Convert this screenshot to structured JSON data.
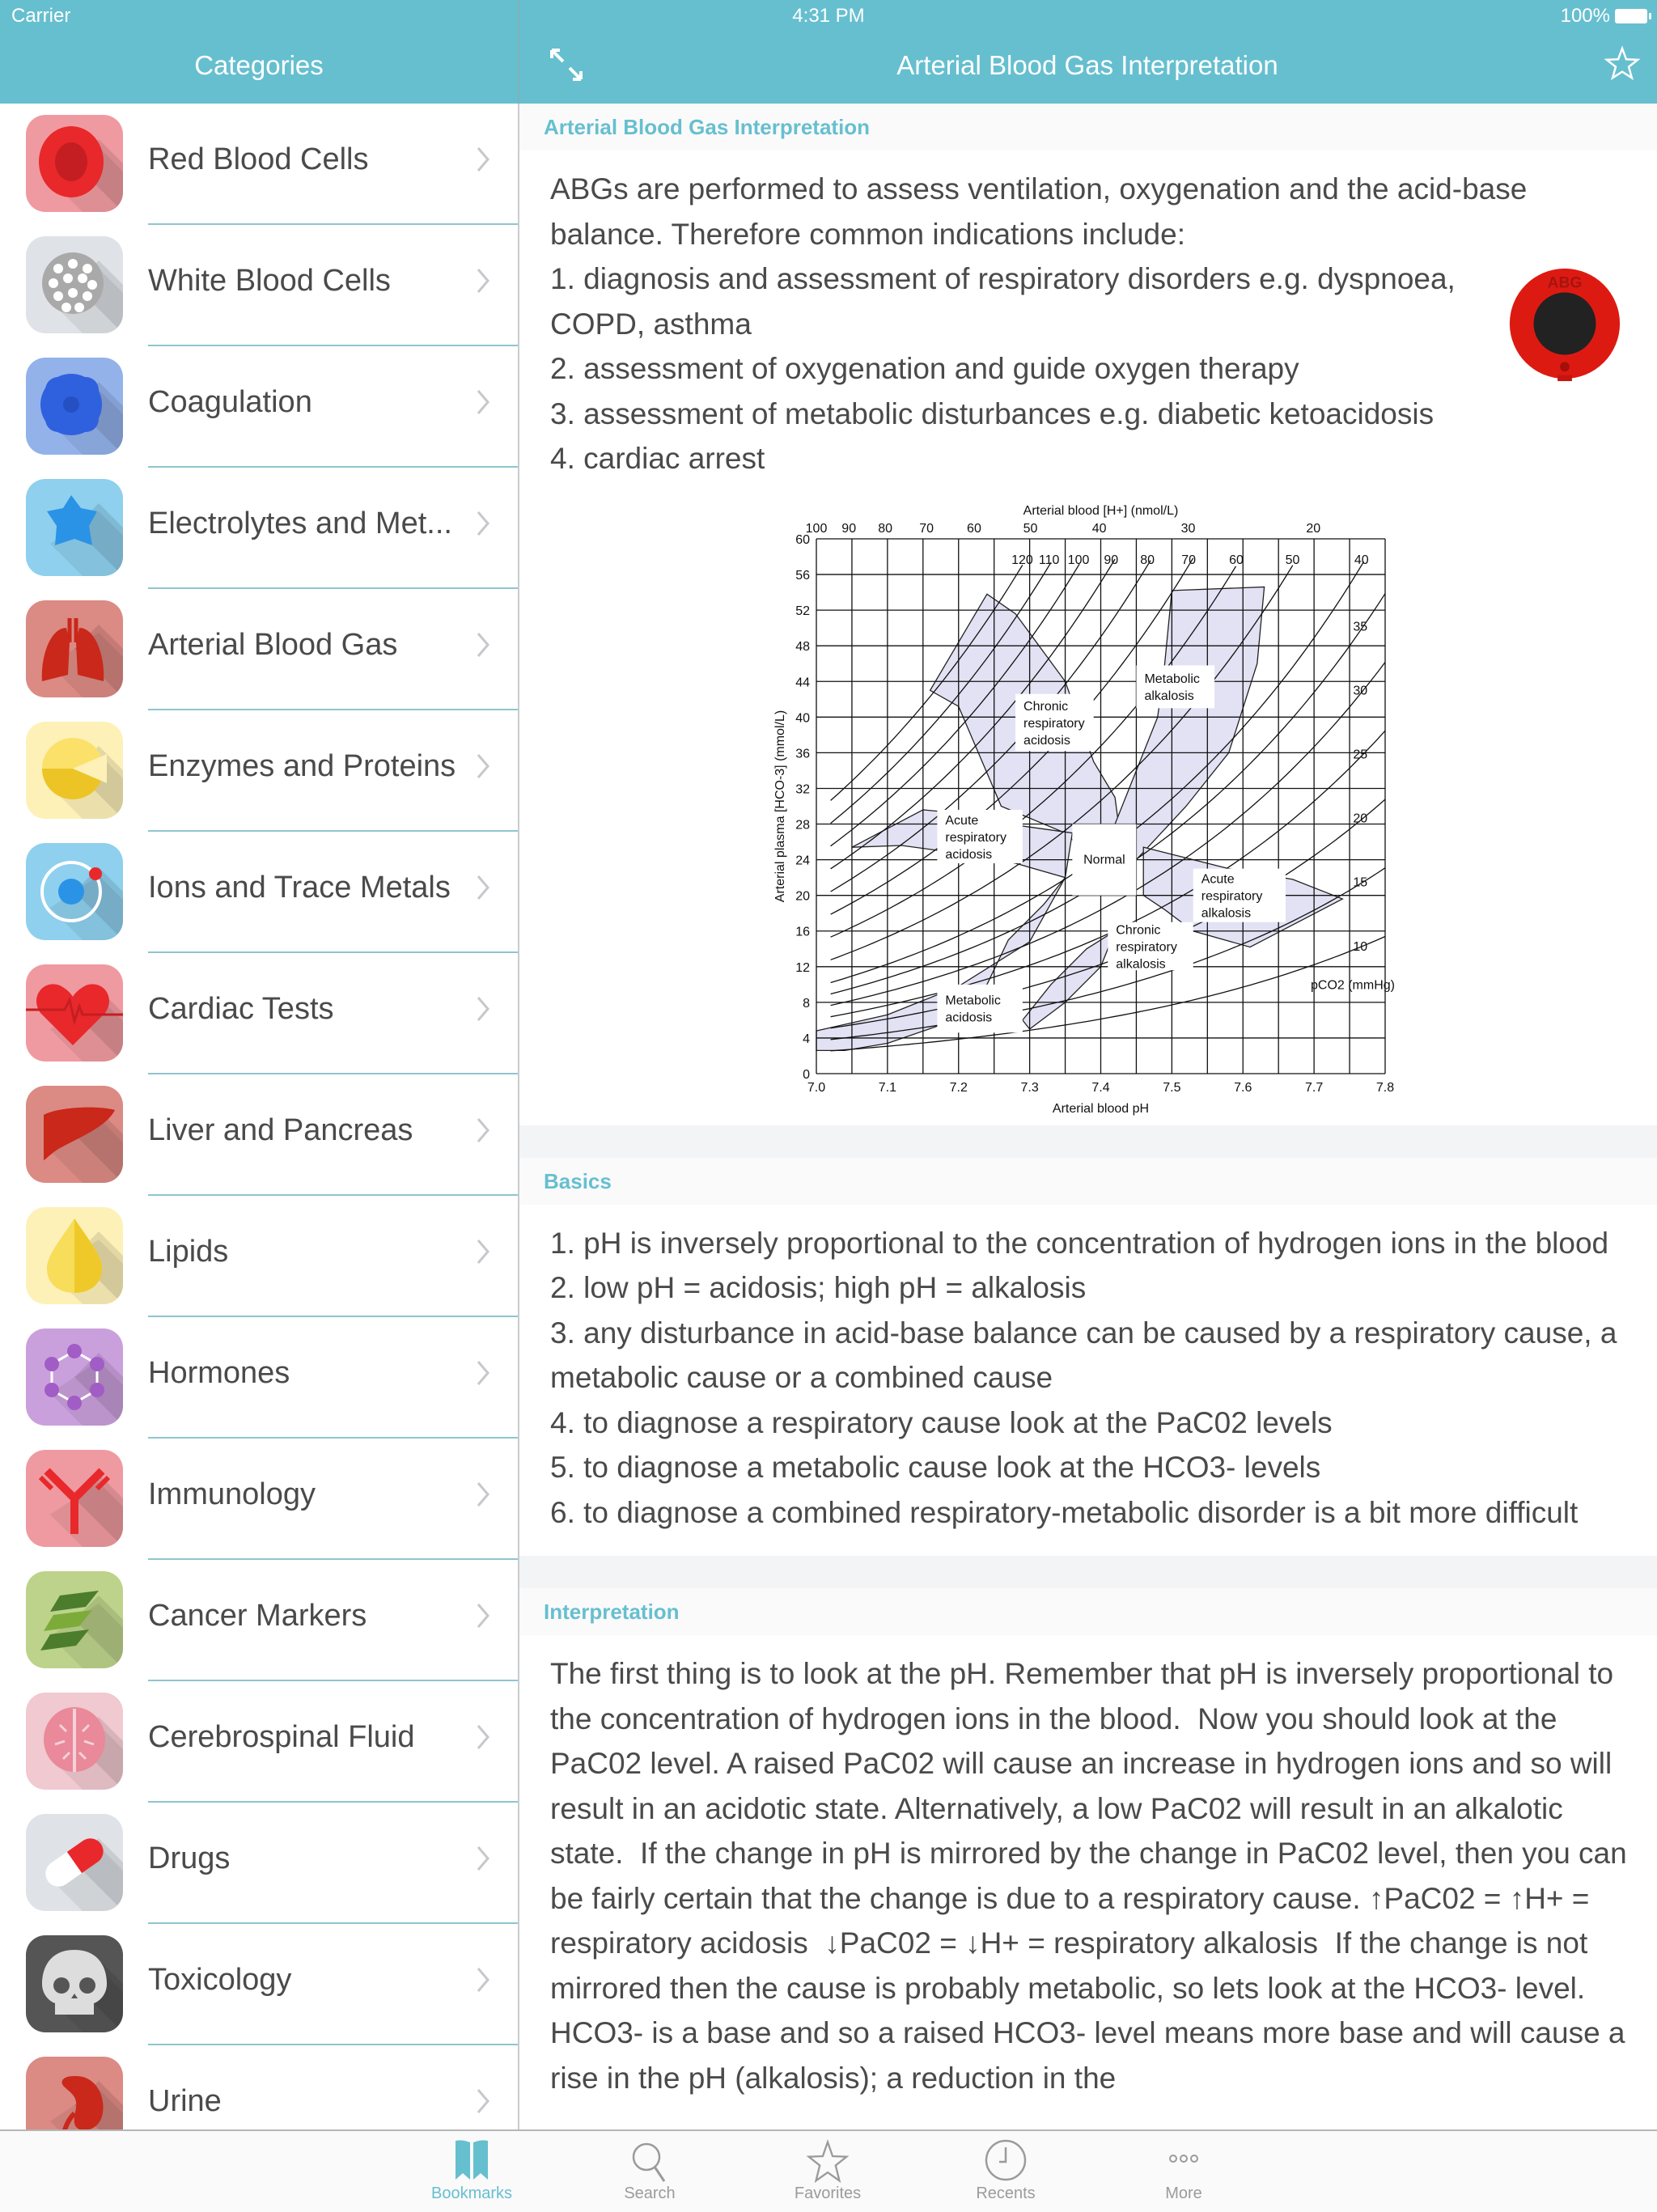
{
  "status_bar": {
    "carrier": "Carrier",
    "time": "4:31 PM",
    "battery": "100%"
  },
  "sidebar": {
    "title": "Categories",
    "items": [
      {
        "label": "Red Blood Cells",
        "icon": "red-blood-cell-icon",
        "bg": "#ef9aa0",
        "fg": "#e8282b"
      },
      {
        "label": "White Blood Cells",
        "icon": "white-blood-cell-icon",
        "bg": "#dfe3e7",
        "fg": "#a9a9a9"
      },
      {
        "label": "Coagulation",
        "icon": "coagulation-icon",
        "bg": "#93b2ea",
        "fg": "#2f61df"
      },
      {
        "label": "Electrolytes and Met...",
        "icon": "electrolytes-icon",
        "bg": "#8ed0ee",
        "fg": "#2a93e6"
      },
      {
        "label": "Arterial Blood Gas",
        "icon": "lungs-icon",
        "bg": "#db8a84",
        "fg": "#c9281a"
      },
      {
        "label": "Enzymes and Proteins",
        "icon": "enzyme-icon",
        "bg": "#fdf1b8",
        "fg": "#f3d33a"
      },
      {
        "label": "Ions and Trace Metals",
        "icon": "ion-icon",
        "bg": "#8ed0ee",
        "fg": "#2a93e6"
      },
      {
        "label": "Cardiac Tests",
        "icon": "heart-icon",
        "bg": "#ef9aa0",
        "fg": "#e8282b"
      },
      {
        "label": "Liver and Pancreas",
        "icon": "liver-icon",
        "bg": "#db8a84",
        "fg": "#c9281a"
      },
      {
        "label": "Lipids",
        "icon": "lipid-drop-icon",
        "bg": "#fdf1b8",
        "fg": "#efc92a"
      },
      {
        "label": "Hormones",
        "icon": "hormone-molecule-icon",
        "bg": "#caa0dc",
        "fg": "#a25cc6"
      },
      {
        "label": "Immunology",
        "icon": "antibody-icon",
        "bg": "#ef9aa0",
        "fg": "#e8282b"
      },
      {
        "label": "Cancer Markers",
        "icon": "dna-strand-icon",
        "bg": "#bdd38b",
        "fg": "#4f8a2a"
      },
      {
        "label": "Cerebrospinal Fluid",
        "icon": "brain-icon",
        "bg": "#f1c9d0",
        "fg": "#e9899a"
      },
      {
        "label": "Drugs",
        "icon": "pill-icon",
        "bg": "#dfe3e7",
        "fg": "#e8282b"
      },
      {
        "label": "Toxicology",
        "icon": "skull-icon",
        "bg": "#555555",
        "fg": "#dddddd"
      },
      {
        "label": "Urine",
        "icon": "kidney-icon",
        "bg": "#db8a84",
        "fg": "#c9281a"
      }
    ]
  },
  "nav": {
    "title": "Arterial Blood Gas Interpretation"
  },
  "colors": {
    "accent": "#66bfcf",
    "text": "#4a4a4a",
    "region_fill": "#e2e2f4"
  },
  "sections": [
    {
      "heading": "Arterial Blood Gas Interpretation",
      "paragraphs": [
        "ABGs are performed to assess ventilation, oxygenation and the acid-base balance. Therefore common indications include:",
        "1. diagnosis and assessment of respiratory disorders e.g. dyspnoea, COPD, asthma",
        "2. assessment of oxygenation and guide oxygen therapy",
        "3. assessment of metabolic disturbances e.g. diabetic ketoacidosis",
        "4. cardiac arrest"
      ],
      "image_label": "ABG"
    },
    {
      "heading": "Basics",
      "paragraphs": [
        "1. pH is inversely proportional to the concentration of hydrogen ions in the blood",
        "2. low pH = acidosis; high pH = alkalosis",
        "3. any disturbance in acid-base balance can be caused by a respiratory cause, a   metabolic cause or a combined cause",
        "4. to diagnose a respiratory cause look at the PaC02 levels",
        "5. to diagnose a metabolic cause look at the HCO3- levels",
        "6. to diagnose a combined respiratory-metabolic disorder is a bit more difficult"
      ]
    },
    {
      "heading": "Interpretation",
      "paragraphs": [
        "The first thing is to look at the pH. Remember that pH is inversely proportional to the concentration of hydrogen ions in the blood.  Now you should look at the PaC02 level. A raised PaC02 will cause an increase in hydrogen ions and so will result in an acidotic state. Alternatively, a low PaC02 will result in an alkalotic state.  If the change in pH is mirrored by the change in PaC02 level, then you can be fairly certain that the change is due to a respiratory cause. ↑PaC02 = ↑H+ = respiratory acidosis  ↓PaC02 = ↓H+ = respiratory alkalosis  If the change is not mirrored then the cause is probably metabolic, so lets look at the HCO3- level.  HCO3- is a base and so a raised HCO3- level means more base and will cause a rise in the pH (alkalosis); a reduction in the"
      ]
    }
  ],
  "chart_data": {
    "type": "line",
    "title": "",
    "xlabel": "Arterial blood pH",
    "ylabel": "Arterial plasma [HCO-3] (mmol/L)",
    "top_axis_label": "Arterial blood [H+] (nmol/L)",
    "xlim": [
      7.0,
      7.8
    ],
    "ylim": [
      0,
      60
    ],
    "x_ticks": [
      "7.0",
      "7.1",
      "7.2",
      "7.3",
      "7.4",
      "7.5",
      "7.6",
      "7.7",
      "7.8"
    ],
    "y_ticks": [
      "0",
      "4",
      "8",
      "12",
      "16",
      "20",
      "24",
      "28",
      "32",
      "36",
      "40",
      "44",
      "48",
      "52",
      "56",
      "60"
    ],
    "top_ticks": [
      "100",
      "90",
      "80",
      "70",
      "60",
      "50",
      "40",
      "30",
      "20"
    ],
    "grid": true,
    "isopleth_label": "pCO2 (mmHg)",
    "isopleths_mmHg": [
      120,
      110,
      100,
      90,
      80,
      70,
      60,
      50,
      40,
      35,
      30,
      25,
      20,
      15,
      10
    ],
    "regions": [
      {
        "name": "Chronic respiratory acidosis",
        "label_at": [
          7.28,
          40.5
        ]
      },
      {
        "name": "Metabolic alkalosis",
        "label_at": [
          7.45,
          45
        ]
      },
      {
        "name": "Acute respiratory acidosis",
        "label_at": [
          7.2,
          27
        ]
      },
      {
        "name": "Normal",
        "label_at": [
          7.4,
          24
        ]
      },
      {
        "name": "Acute respiratory alkalosis",
        "label_at": [
          7.58,
          20
        ]
      },
      {
        "name": "Chronic respiratory alkalosis",
        "label_at": [
          7.47,
          13
        ]
      },
      {
        "name": "Metabolic acidosis",
        "label_at": [
          7.22,
          8
        ]
      }
    ]
  },
  "tabbar": {
    "items": [
      {
        "label": "Bookmarks",
        "icon": "bookmarks-icon",
        "active": true
      },
      {
        "label": "Search",
        "icon": "search-icon",
        "active": false
      },
      {
        "label": "Favorites",
        "icon": "star-icon",
        "active": false
      },
      {
        "label": "Recents",
        "icon": "clock-icon",
        "active": false
      },
      {
        "label": "More",
        "icon": "more-icon",
        "active": false
      }
    ]
  }
}
